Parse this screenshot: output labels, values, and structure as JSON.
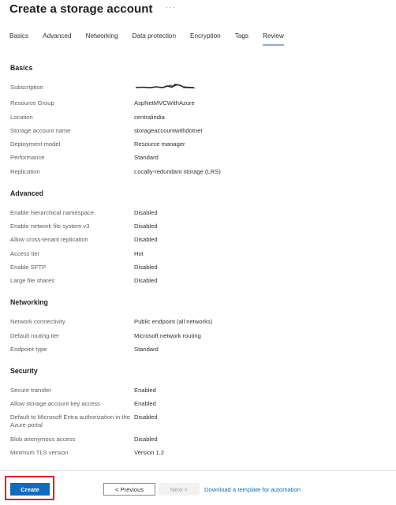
{
  "header": {
    "title": "Create a storage account",
    "more_icon": "ellipsis-icon",
    "more_glyph": "···"
  },
  "tabs": [
    {
      "label": "Basics",
      "active": false
    },
    {
      "label": "Advanced",
      "active": false
    },
    {
      "label": "Networking",
      "active": false
    },
    {
      "label": "Data protection",
      "active": false
    },
    {
      "label": "Encryption",
      "active": false
    },
    {
      "label": "Tags",
      "active": false
    },
    {
      "label": "Review",
      "active": true
    }
  ],
  "sections": {
    "basics": {
      "title": "Basics",
      "rows": [
        {
          "label": "Subscription",
          "value": "",
          "redacted": true
        },
        {
          "label": "Resource Group",
          "value": "AspNetMVCWithAzure"
        },
        {
          "label": "Location",
          "value": "centralindia"
        },
        {
          "label": "Storage account name",
          "value": "storageaccountwithdotnet"
        },
        {
          "label": "Deployment model",
          "value": "Resource manager"
        },
        {
          "label": "Performance",
          "value": "Standard"
        },
        {
          "label": "Replication",
          "value": "Locally-redundant storage (LRS)"
        }
      ]
    },
    "advanced": {
      "title": "Advanced",
      "rows": [
        {
          "label": "Enable hierarchical namespace",
          "value": "Disabled"
        },
        {
          "label": "Enable network file system v3",
          "value": "Disabled"
        },
        {
          "label": "Allow cross-tenant replication",
          "value": "Disabled"
        },
        {
          "label": "Access tier",
          "value": "Hot"
        },
        {
          "label": "Enable SFTP",
          "value": "Disabled"
        },
        {
          "label": "Large file shares",
          "value": "Disabled"
        }
      ]
    },
    "networking": {
      "title": "Networking",
      "rows": [
        {
          "label": "Network connectivity",
          "value": "Public endpoint (all networks)"
        },
        {
          "label": "Default routing tier",
          "value": "Microsoft network routing"
        },
        {
          "label": "Endpoint type",
          "value": "Standard"
        }
      ]
    },
    "security": {
      "title": "Security",
      "rows": [
        {
          "label": "Secure transfer",
          "value": "Enabled"
        },
        {
          "label": "Allow storage account key access",
          "value": "Enabled"
        },
        {
          "label": "Default to Microsoft Entra authorization in the Azure portal",
          "value": "Disabled"
        },
        {
          "label": "Blob anonymous access",
          "value": "Disabled"
        },
        {
          "label": "Minimum TLS version",
          "value": "Version 1.2"
        }
      ]
    }
  },
  "footer": {
    "create_label": "Create",
    "previous_label": "< Previous",
    "next_label": "Next >",
    "next_disabled": true,
    "template_link": "Download a template for automation"
  },
  "colors": {
    "primary": "#0f6cbd",
    "highlight": "#e81c1c",
    "active_tab_underline": "#8aa8d8"
  }
}
